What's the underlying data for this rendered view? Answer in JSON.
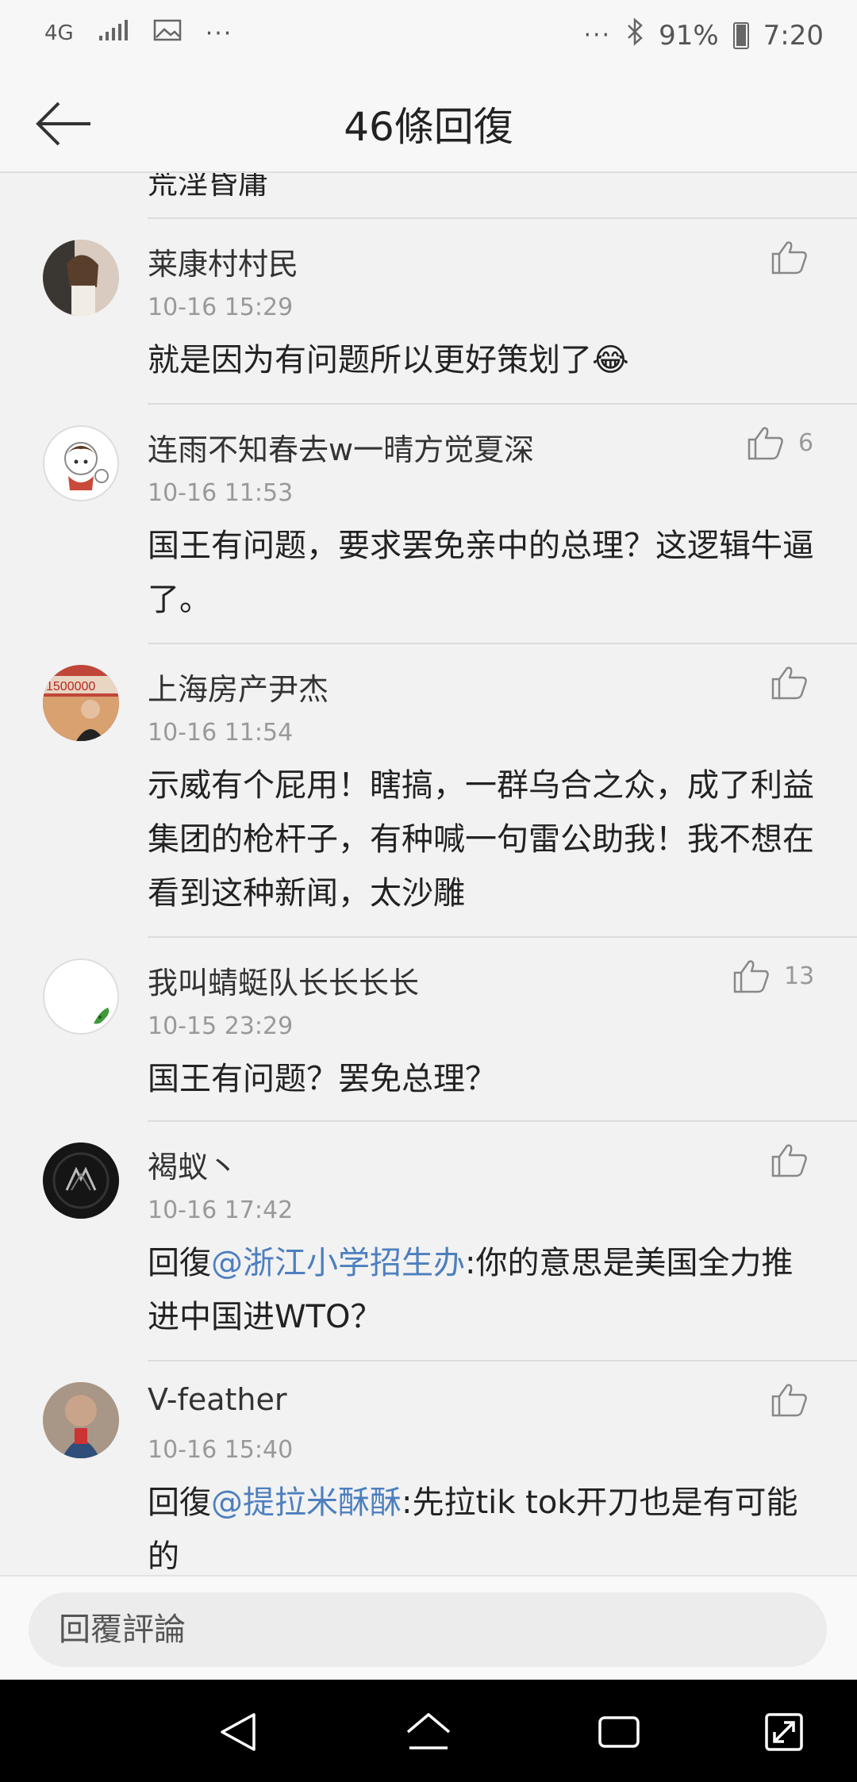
{
  "status_bar": {
    "network": "4G",
    "more": "···",
    "more_right": "···",
    "battery": "91%",
    "time": "7:20"
  },
  "header": {
    "title": "46條回復",
    "back_icon": "arrow-left-icon"
  },
  "partial_comment": {
    "text": "荒淫昏庸"
  },
  "comments": [
    {
      "username": "莱康村村民",
      "time": "10-16 15:29",
      "text": "就是因为有问题所以更好策划了😂",
      "likes": ""
    },
    {
      "username": "连雨不知春去w一晴方觉夏深",
      "time": "10-16 11:53",
      "text": "国王有问题，要求罢免亲中的总理？这逻辑牛逼了。",
      "likes": "6"
    },
    {
      "username": "上海房产尹杰",
      "time": "10-16 11:54",
      "text": "示威有个屁用！瞎搞，一群乌合之众，成了利益集团的枪杆子，有种喊一句雷公助我！我不想在看到这种新闻，太沙雕",
      "likes": ""
    },
    {
      "username": "我叫蜻蜓队长长长长",
      "time": "10-15 23:29",
      "text": "国王有问题？罢免总理？",
      "likes": "13"
    },
    {
      "username": "褐蚁丶",
      "time": "10-16 17:42",
      "reply_prefix": "回復",
      "mention": "@浙江小学招生办",
      "text": ":你的意思是美国全力推进中国进WTO？",
      "likes": ""
    },
    {
      "username": "V-feather",
      "time": "10-16 15:40",
      "reply_prefix": "回復",
      "mention": "@提拉米酥酥",
      "text": ":先拉tik tok开刀也是有可能的",
      "likes": ""
    }
  ],
  "reply_bar": {
    "placeholder": "回覆評論"
  },
  "colors": {
    "background": "#f2f2f2",
    "mention": "#4d7fbf",
    "secondary_text": "#999999",
    "navbar": "#000000"
  }
}
